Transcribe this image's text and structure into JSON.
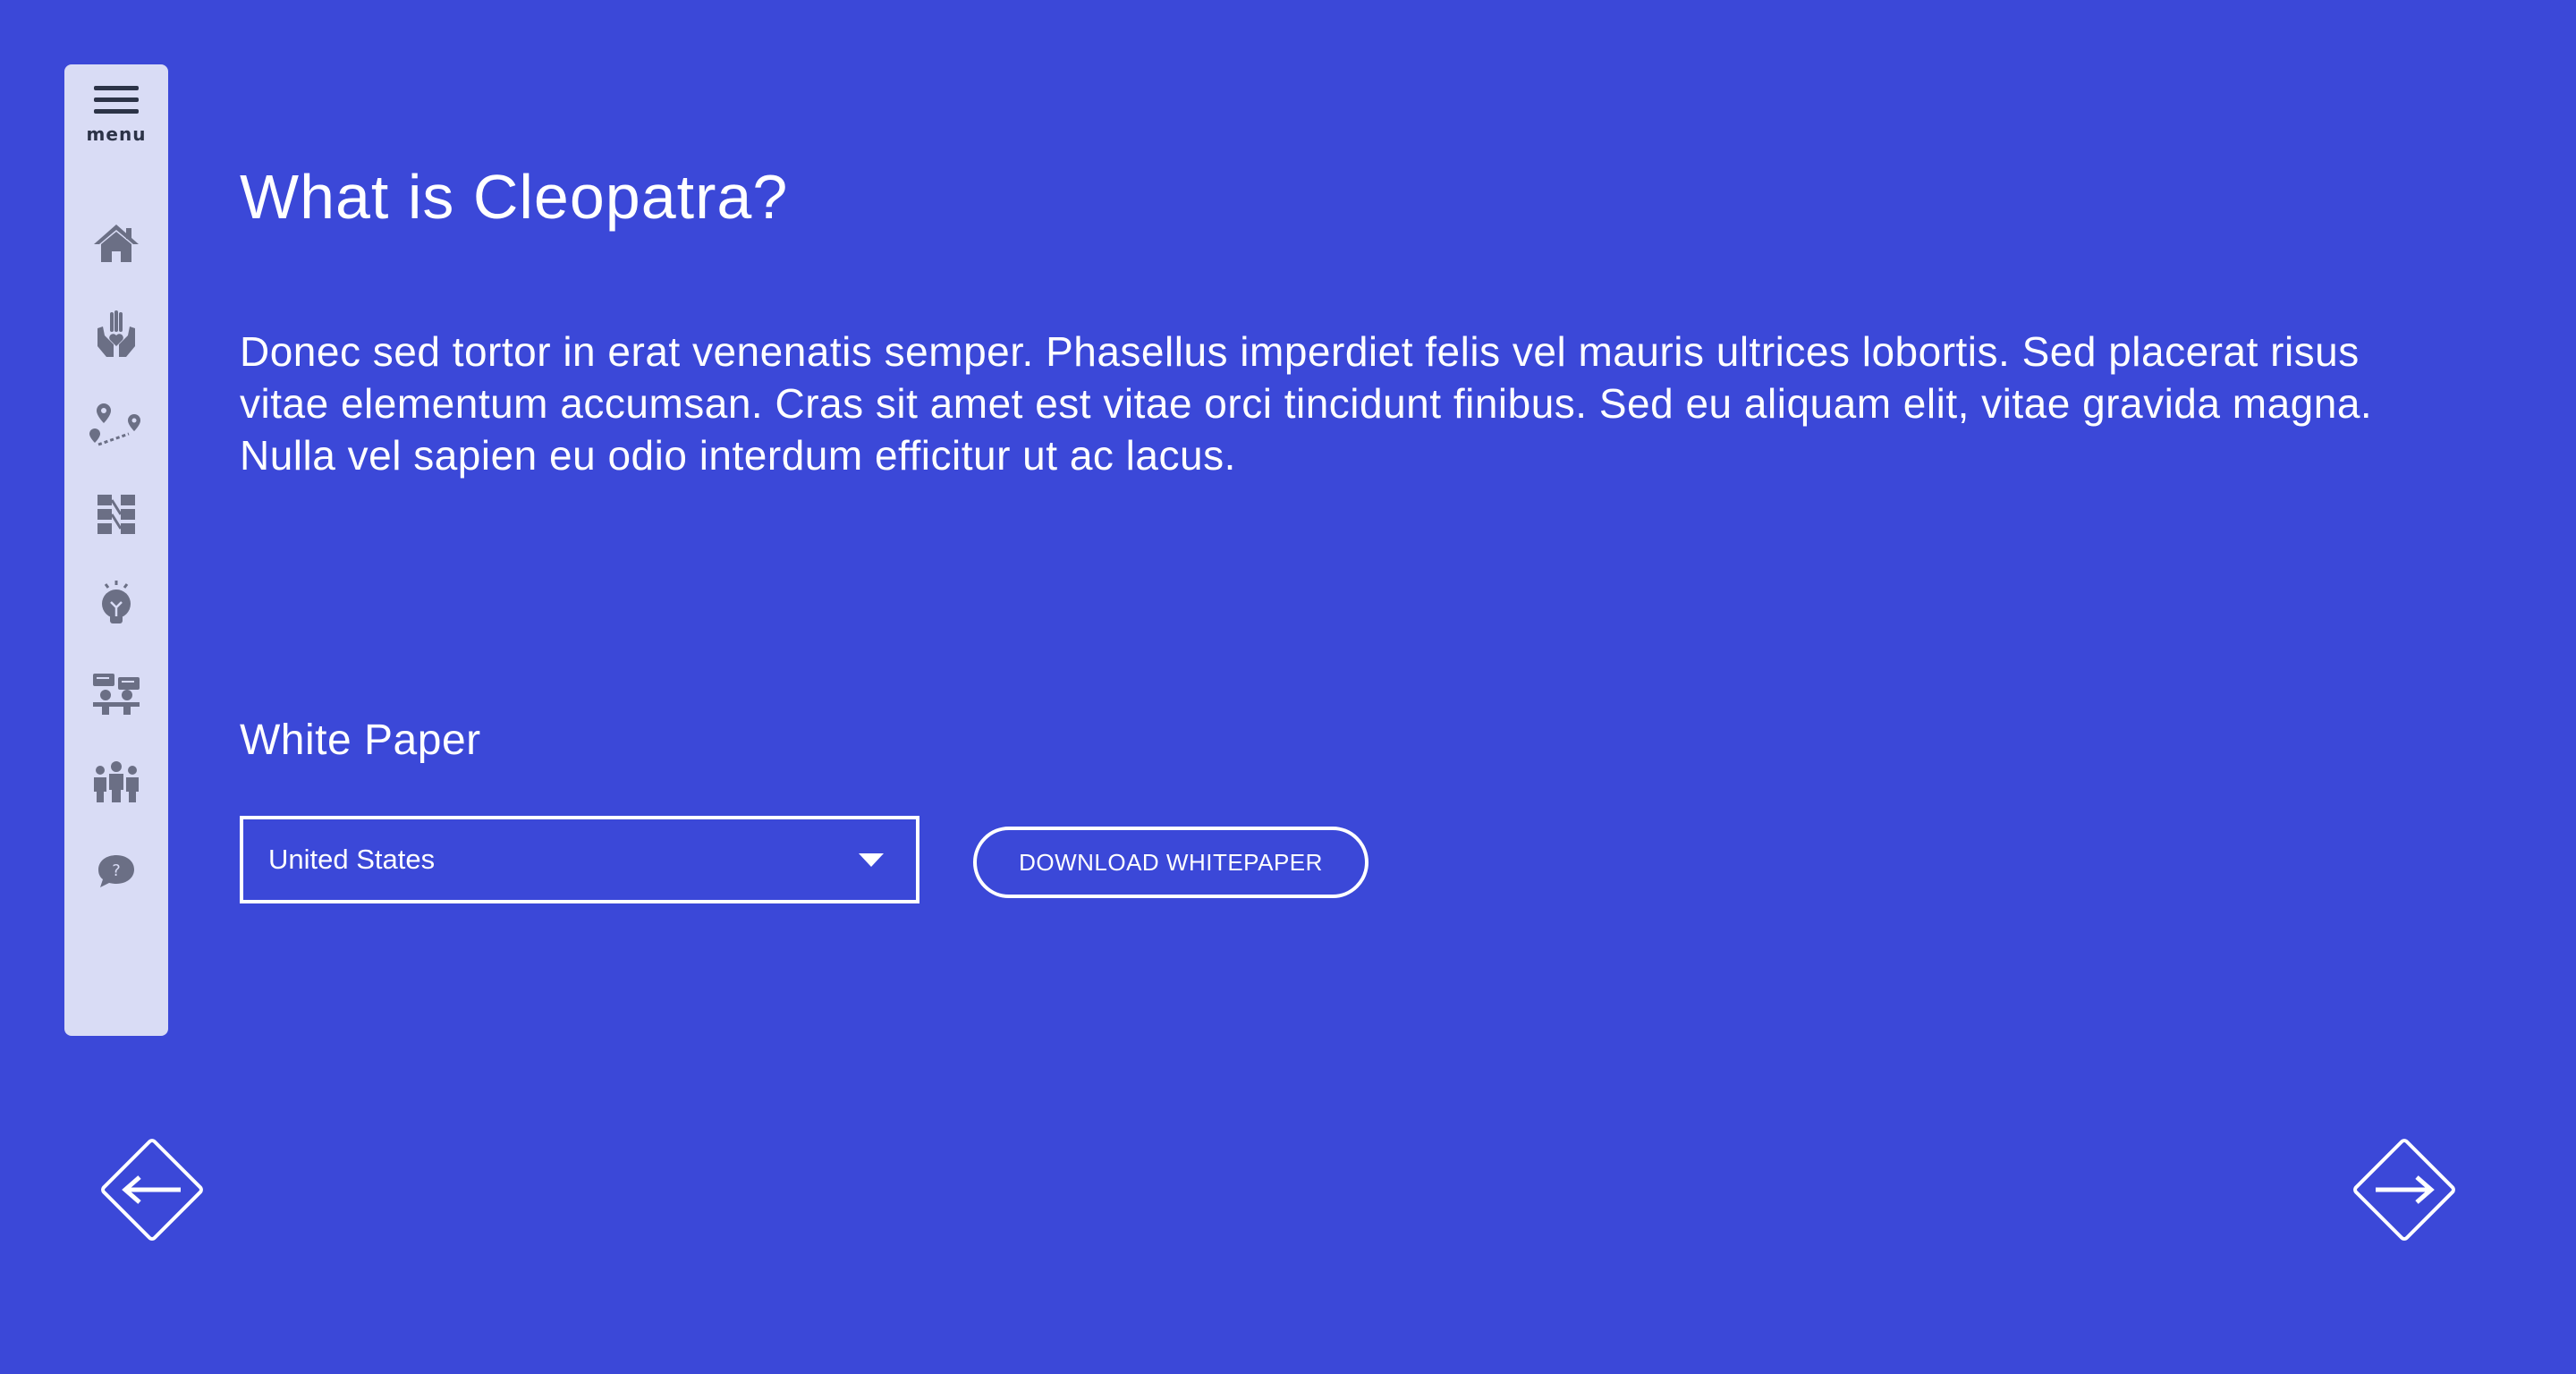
{
  "sidebar": {
    "menu_label": "menu",
    "items": [
      {
        "icon": "home-icon"
      },
      {
        "icon": "hands-heart-icon"
      },
      {
        "icon": "map-route-icon"
      },
      {
        "icon": "workflow-icon"
      },
      {
        "icon": "lightbulb-icon"
      },
      {
        "icon": "meeting-icon"
      },
      {
        "icon": "team-icon"
      },
      {
        "icon": "help-chat-icon"
      }
    ],
    "icon_color": "#6b6f85",
    "background": "#d9dcf5"
  },
  "main": {
    "title": "What is Cleopatra?",
    "body": "Donec sed tortor in erat venenatis semper. Phasellus imperdiet felis vel mauris ultrices lobortis. Sed placerat risus vitae elementum accumsan. Cras sit amet est vitae orci tincidunt finibus. Sed eu aliquam elit, vitae gravida magna. Nulla vel sapien eu odio interdum efficitur ut ac lacus.",
    "section_heading": "White Paper",
    "country_select": {
      "value": "United States"
    },
    "download_button": "DOWNLOAD WHITEPAPER"
  },
  "navigation": {
    "prev_icon": "arrow-left-icon",
    "next_icon": "arrow-right-icon"
  },
  "colors": {
    "background": "#3b48d8",
    "text": "#ffffff"
  }
}
